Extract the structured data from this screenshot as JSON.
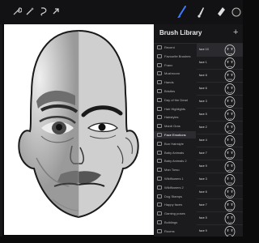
{
  "toolbar": {
    "left_icons": [
      "wrench-icon",
      "magic-wand-icon",
      "selection-icon",
      "transform-arrow-icon"
    ],
    "right_icons": [
      "brush-icon",
      "smudge-icon",
      "eraser-icon",
      "color-swatch-icon"
    ],
    "accent": "#3f7bff"
  },
  "panel": {
    "title": "Brush Library",
    "add_icon": "+",
    "library": [
      "Recent",
      "Favourite Brushes",
      "Franx",
      "Mushroom",
      "Hands",
      "Bristles",
      "Day of the Dead",
      "Hair Highlights",
      "Hairstyles",
      "Mardi Gras",
      "Face Emotions",
      "Bun Hairstyle",
      "Baby Animals",
      "Baby Animals 2",
      "Man Torso",
      "Wildflowers 1",
      "Wildflowers 2",
      "Dog Stamps",
      "Happy faces",
      "Gaming poses",
      "Buildings",
      "Rooms"
    ],
    "selected_library_index": 10,
    "brushes": [
      {
        "name": "face 10"
      },
      {
        "name": "face 1"
      },
      {
        "name": "face 8"
      },
      {
        "name": "face 6"
      },
      {
        "name": "face 3"
      },
      {
        "name": "face 5"
      },
      {
        "name": "face 2"
      },
      {
        "name": "face 4"
      },
      {
        "name": "face 7"
      },
      {
        "name": "face 9"
      },
      {
        "name": "face 3"
      },
      {
        "name": "face 6"
      },
      {
        "name": "face 7"
      },
      {
        "name": "face 5"
      },
      {
        "name": "face 9"
      }
    ],
    "selected_brush_index": 0
  }
}
